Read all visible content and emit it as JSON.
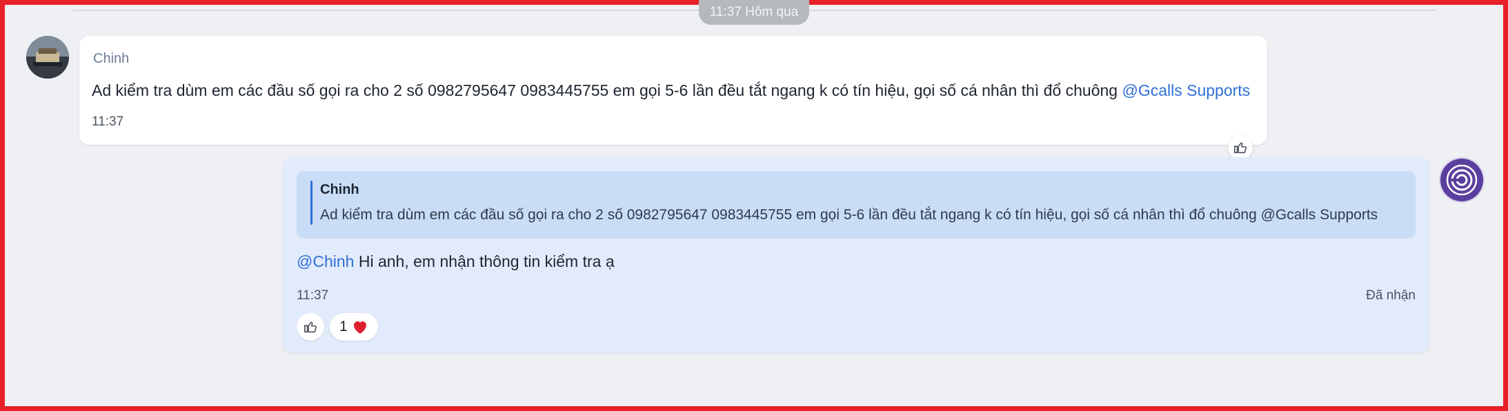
{
  "date_separator": "11:37 Hôm qua",
  "incoming": {
    "sender": "Chinh",
    "text": "Ad kiểm tra dùm em các đầu số gọi ra cho 2 số 0982795647  0983445755 em gọi 5-6 lần đều tắt ngang k có tín hiệu, gọi số cá nhân thì đổ chuông ",
    "mention": "@Gcalls Supports",
    "time": "11:37",
    "avatar_icon": "user-photo-avatar"
  },
  "outgoing": {
    "quote": {
      "author": "Chinh",
      "text": "Ad kiểm tra dùm em các đầu số gọi ra cho 2 số 0982795647 0983445755 em gọi 5-6 lần đều tắt ngang k có tín hiệu, gọi số cá nhân thì đổ chuông @Gcalls Supports"
    },
    "mention": "@Chinh",
    "text": " Hi anh, em nhận thông tin kiểm tra ạ",
    "time": "11:37",
    "status": "Đã nhận",
    "reactions": [
      {
        "icon": "heart-icon",
        "count": "1"
      }
    ],
    "avatar_icon": "gcalls-logo-icon"
  },
  "colors": {
    "accent_link": "#2f6fd6",
    "outgoing_bubble": "#e2ebfb",
    "quote_bg": "#c9ddf7",
    "frame_border": "#e8202a",
    "background": "#eef0f3"
  }
}
